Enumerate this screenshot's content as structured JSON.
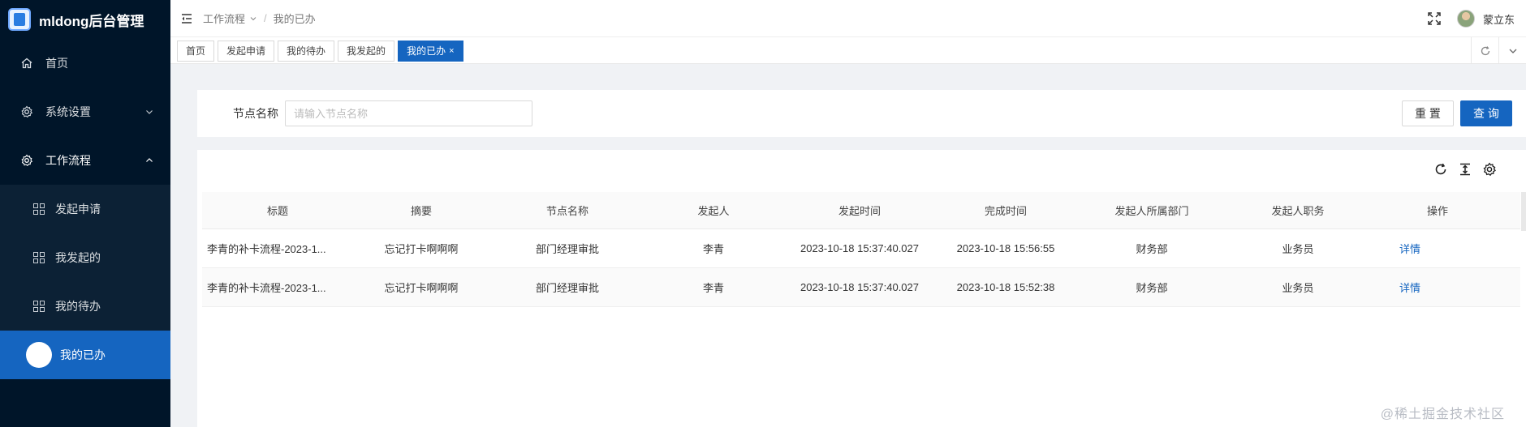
{
  "app": {
    "title": "mldong后台管理"
  },
  "sidebar": {
    "items": [
      {
        "label": "首页",
        "icon": "home-icon"
      },
      {
        "label": "系统设置",
        "icon": "gear-icon"
      },
      {
        "label": "工作流程",
        "icon": "gear-icon"
      }
    ],
    "workflow_sub": [
      {
        "label": "发起申请",
        "icon": "app-grid-icon"
      },
      {
        "label": "我发起的",
        "icon": "app-grid-icon"
      },
      {
        "label": "我的待办",
        "icon": "app-grid-icon"
      },
      {
        "label": "我的已办"
      }
    ]
  },
  "header": {
    "breadcrumb": [
      "工作流程",
      "我的已办"
    ],
    "breadcrumb_sep": "/",
    "username": "蒙立东"
  },
  "tabs": [
    {
      "label": "首页"
    },
    {
      "label": "发起申请"
    },
    {
      "label": "我的待办"
    },
    {
      "label": "我发起的"
    },
    {
      "label": "我的已办",
      "close": "×"
    }
  ],
  "search": {
    "label": "节点名称",
    "placeholder": "请输入节点名称",
    "value": "",
    "reset_label": "重 置",
    "submit_label": "查 询"
  },
  "table": {
    "columns": [
      "标题",
      "摘要",
      "节点名称",
      "发起人",
      "发起时间",
      "完成时间",
      "发起人所属部门",
      "发起人职务",
      "操作"
    ],
    "rows": [
      {
        "title": "李青的补卡流程-2023-1...",
        "summary": "忘记打卡啊啊啊",
        "node": "部门经理审批",
        "initiator": "李青",
        "start": "2023-10-18 15:37:40.027",
        "end": "2023-10-18 15:56:55",
        "dept": "财务部",
        "post": "业务员",
        "action": "详情"
      },
      {
        "title": "李青的补卡流程-2023-1...",
        "summary": "忘记打卡啊啊啊",
        "node": "部门经理审批",
        "initiator": "李青",
        "start": "2023-10-18 15:37:40.027",
        "end": "2023-10-18 15:52:38",
        "dept": "财务部",
        "post": "业务员",
        "action": "详情"
      }
    ]
  },
  "watermark": "@稀土掘金技术社区",
  "colors": {
    "sidebar_bg": "#001529",
    "primary": "#1565c0",
    "page_bg": "#f0f2f5"
  }
}
